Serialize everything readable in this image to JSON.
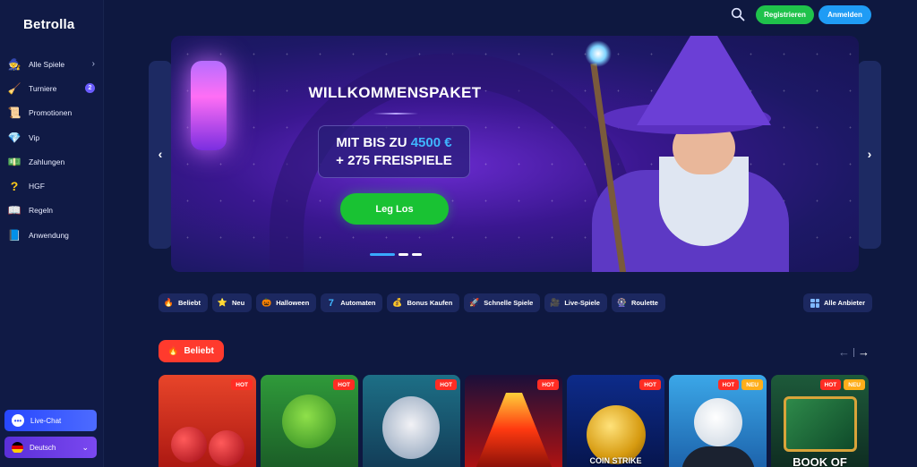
{
  "brand": {
    "name": "Betrolla"
  },
  "sidebar": {
    "items": [
      {
        "label": "Alle Spiele",
        "icon": "wizard-hat-icon",
        "glyph": "🧙"
      },
      {
        "label": "Turniere",
        "icon": "broom-icon",
        "glyph": "🧹",
        "badge": "2"
      },
      {
        "label": "Promotionen",
        "icon": "scroll-icon",
        "glyph": "📜"
      },
      {
        "label": "Vip",
        "icon": "diamond-icon",
        "glyph": "💎"
      },
      {
        "label": "Zahlungen",
        "icon": "money-icon",
        "glyph": "💵"
      },
      {
        "label": "HGF",
        "icon": "question-mark-icon",
        "glyph": "?"
      },
      {
        "label": "Regeln",
        "icon": "book-icon",
        "glyph": "📖"
      },
      {
        "label": "Anwendung",
        "icon": "app-icon",
        "glyph": "📘"
      }
    ],
    "live_chat": "Live-Chat",
    "language": "Deutsch"
  },
  "header": {
    "register": "Registrieren",
    "login": "Anmelden"
  },
  "hero": {
    "title": "WILLKOMMENSPAKET",
    "offer_prefix": "MIT BIS ZU",
    "offer_amount": "4500 €",
    "offer_line2": "+ 275 FREISPIELE",
    "cta": "Leg Los",
    "slides": 3,
    "active_slide": 1
  },
  "categories": [
    {
      "label": "Beliebt",
      "icon": "fire-icon",
      "glyph": "🔥"
    },
    {
      "label": "Neu",
      "icon": "star-icon",
      "glyph": "⭐"
    },
    {
      "label": "Halloween",
      "icon": "pumpkin-icon",
      "glyph": "🎃"
    },
    {
      "label": "Automaten",
      "icon": "seven-icon",
      "glyph": "7"
    },
    {
      "label": "Bonus Kaufen",
      "icon": "cash-icon",
      "glyph": "💰"
    },
    {
      "label": "Schnelle Spiele",
      "icon": "rocket-icon",
      "glyph": "🚀"
    },
    {
      "label": "Live-Spiele",
      "icon": "live-icon",
      "glyph": "🎥"
    },
    {
      "label": "Roulette",
      "icon": "roulette-icon",
      "glyph": "🎡"
    }
  ],
  "all_providers": "Alle Anbieter",
  "section": {
    "label": "Beliebt"
  },
  "games": [
    {
      "tags": [
        "HOT"
      ],
      "title": ""
    },
    {
      "tags": [
        "HOT"
      ],
      "title": ""
    },
    {
      "tags": [
        "HOT"
      ],
      "title": ""
    },
    {
      "tags": [
        "HOT"
      ],
      "title": ""
    },
    {
      "tags": [
        "HOT"
      ],
      "title": "COIN STRIKE"
    },
    {
      "tags": [
        "HOT",
        "NEU"
      ],
      "title": ""
    },
    {
      "tags": [
        "HOT",
        "NEU"
      ],
      "title": "BOOK OF"
    }
  ],
  "colors": {
    "accent_green": "#1fc24b",
    "accent_blue": "#1f9cf5",
    "hot": "#ff2d24",
    "neu": "#ffae1a"
  }
}
